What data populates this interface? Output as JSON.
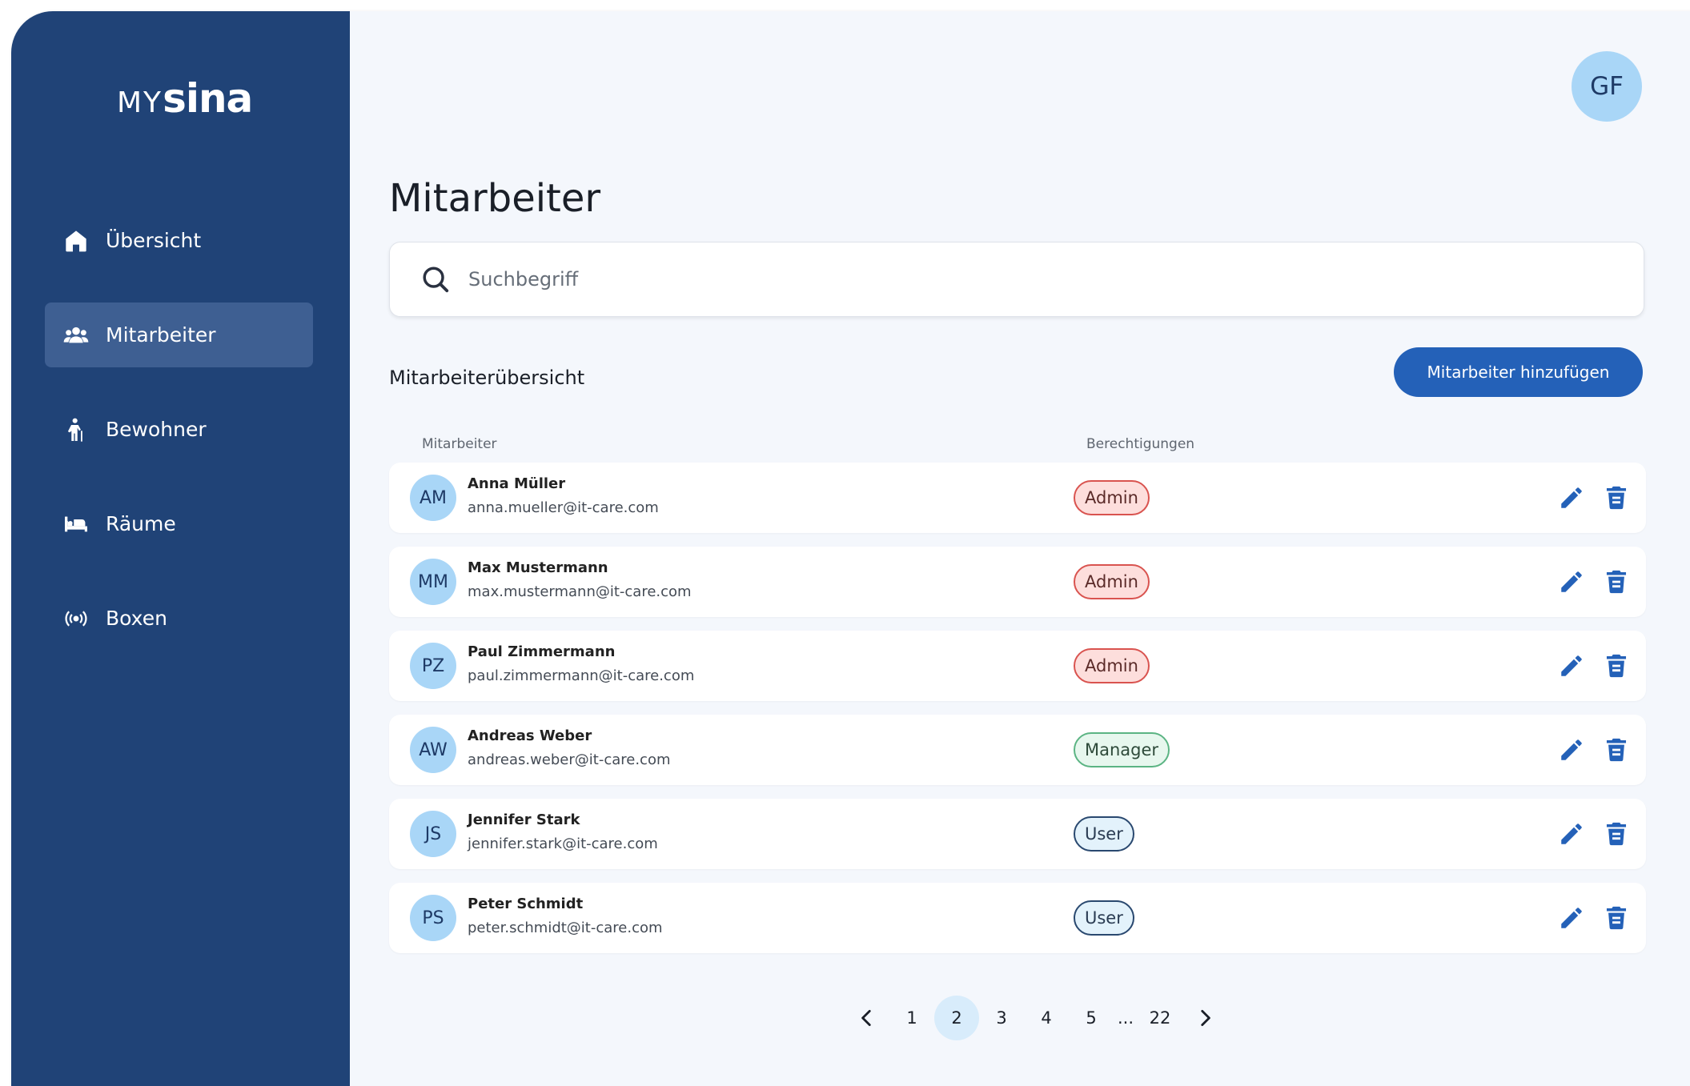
{
  "brand": {
    "logo_prefix": "MY",
    "logo_name": "sina"
  },
  "sidebar": {
    "items": [
      {
        "label": "Übersicht",
        "icon": "home-icon",
        "active": false
      },
      {
        "label": "Mitarbeiter",
        "icon": "users-icon",
        "active": true
      },
      {
        "label": "Bewohner",
        "icon": "elderly-person-icon",
        "active": false
      },
      {
        "label": "Räume",
        "icon": "bed-icon",
        "active": false
      },
      {
        "label": "Boxen",
        "icon": "broadcast-icon",
        "active": false
      }
    ]
  },
  "user": {
    "initials": "GF"
  },
  "page": {
    "title": "Mitarbeiter"
  },
  "search": {
    "placeholder": "Suchbegriff"
  },
  "section": {
    "title": "Mitarbeiterübersicht",
    "add_button_label": "Mitarbeiter hinzufügen"
  },
  "table": {
    "columns": [
      "Mitarbeiter",
      "Berechtigungen"
    ],
    "rows": [
      {
        "initials": "AM",
        "name": "Anna Müller",
        "email": "anna.mueller@it-care.com",
        "role": "Admin"
      },
      {
        "initials": "MM",
        "name": "Max Mustermann",
        "email": "max.mustermann@it-care.com",
        "role": "Admin"
      },
      {
        "initials": "PZ",
        "name": "Paul Zimmermann",
        "email": "paul.zimmermann@it-care.com",
        "role": "Admin"
      },
      {
        "initials": "AW",
        "name": "Andreas Weber",
        "email": "andreas.weber@it-care.com",
        "role": "Manager"
      },
      {
        "initials": "JS",
        "name": "Jennifer Stark",
        "email": "jennifer.stark@it-care.com",
        "role": "User"
      },
      {
        "initials": "PS",
        "name": "Peter Schmidt",
        "email": "peter.schmidt@it-care.com",
        "role": "User"
      }
    ]
  },
  "pagination": {
    "pages": [
      "1",
      "2",
      "3",
      "4",
      "5"
    ],
    "current": "2",
    "ellipsis": "...",
    "last": "22"
  },
  "colors": {
    "sidebar": "#204377",
    "accent": "#2461b8",
    "admin": "#d9534f",
    "manager": "#5bb483",
    "user": "#29486f"
  }
}
